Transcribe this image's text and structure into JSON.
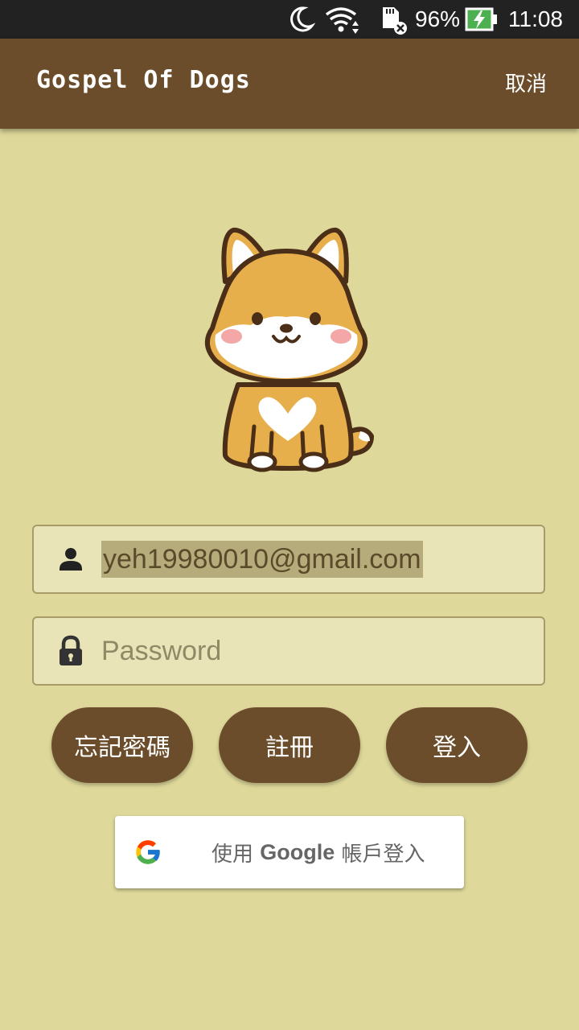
{
  "status_bar": {
    "battery": "96%",
    "time": "11:08",
    "icons": [
      "moon-icon",
      "wifi-icon",
      "sd-card-icon",
      "battery-charging-icon"
    ]
  },
  "app_bar": {
    "title": "Gospel Of Dogs",
    "cancel_label": "取消"
  },
  "login": {
    "email_value": "yeh19980010@gmail.com",
    "password_placeholder": "Password",
    "forgot_password_label": "忘記密碼",
    "register_label": "註冊",
    "login_label": "登入"
  },
  "google_signin": {
    "label_prefix": "使用 ",
    "label_brand": "Google",
    "label_suffix": " 帳戶登入"
  },
  "colors": {
    "background": "#ded89a",
    "app_bar": "#6b4d2b",
    "button": "#6b4d2b",
    "status_bar": "#222222",
    "battery_charging": "#4caf50"
  }
}
